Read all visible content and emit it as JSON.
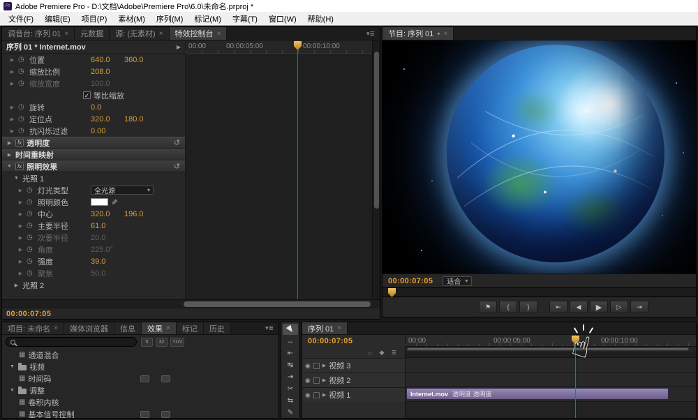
{
  "window": {
    "title": "Adobe Premiere Pro - D:\\文档\\Adobe\\Premiere Pro\\6.0\\未命名.prproj *",
    "app_icon": "Pr"
  },
  "menu": {
    "items": [
      "文件(F)",
      "编辑(E)",
      "项目(P)",
      "素材(M)",
      "序列(M)",
      "标记(M)",
      "字幕(T)",
      "窗口(W)",
      "帮助(H)"
    ]
  },
  "effect_controls": {
    "tabs": [
      {
        "label": "调音台: 序列 01",
        "closable": true,
        "active": false
      },
      {
        "label": "元数据",
        "closable": false,
        "active": false
      },
      {
        "label": "源: (无素材)",
        "closable": true,
        "active": false
      },
      {
        "label": "特效控制台",
        "closable": true,
        "active": true
      }
    ],
    "clip_header": "序列 01 * Internet.mov",
    "ruler_labels": [
      "00:00",
      "00:00:05:00",
      "00:00:10:00"
    ],
    "footer_timecode": "00:00:07:05",
    "rows": [
      {
        "kind": "param",
        "label": "位置",
        "values": [
          "640.0",
          "360.0"
        ],
        "indent": 0
      },
      {
        "kind": "param",
        "label": "缩放比例",
        "values": [
          "208.0"
        ],
        "indent": 0
      },
      {
        "kind": "param",
        "label": "缩放宽度",
        "values": [
          "100.0"
        ],
        "disabled": true,
        "indent": 0
      },
      {
        "kind": "check",
        "label": "等比缩放",
        "checked": true
      },
      {
        "kind": "param",
        "label": "旋转",
        "values": [
          "0.0"
        ],
        "indent": 0
      },
      {
        "kind": "param",
        "label": "定位点",
        "values": [
          "320.0",
          "180.0"
        ],
        "indent": 0
      },
      {
        "kind": "param",
        "label": "抗闪烁过滤",
        "values": [
          "0.00"
        ],
        "indent": 0
      },
      {
        "kind": "section",
        "label": "透明度",
        "fx": true,
        "reset": true,
        "expanded": false
      },
      {
        "kind": "section",
        "label": "时间重映射",
        "expanded": false
      },
      {
        "kind": "section",
        "label": "照明效果",
        "fx": true,
        "reset": true,
        "expanded": true
      },
      {
        "kind": "group",
        "label": "光照 1",
        "expanded": true,
        "indent": 1
      },
      {
        "kind": "dropdown",
        "label": "灯光类型",
        "value": "全光源",
        "indent": 2
      },
      {
        "kind": "color",
        "label": "照明颜色",
        "indent": 2
      },
      {
        "kind": "param",
        "label": "中心",
        "values": [
          "320.0",
          "196.0"
        ],
        "indent": 2
      },
      {
        "kind": "param",
        "label": "主要半径",
        "values": [
          "61.0"
        ],
        "indent": 2
      },
      {
        "kind": "param",
        "label": "次要半径",
        "values": [
          "20.0"
        ],
        "disabled": true,
        "indent": 2
      },
      {
        "kind": "param",
        "label": "角度",
        "values": [
          "225.0°"
        ],
        "disabled": true,
        "indent": 2
      },
      {
        "kind": "param",
        "label": "强度",
        "values": [
          "39.0"
        ],
        "indent": 2
      },
      {
        "kind": "param",
        "label": "聚焦",
        "values": [
          "50.0"
        ],
        "disabled": true,
        "indent": 2
      },
      {
        "kind": "group",
        "label": "光照 2",
        "expanded": false,
        "indent": 1
      }
    ]
  },
  "program_monitor": {
    "tab": "节目: 序列 01",
    "timecode": "00:00:07:05",
    "fit_label": "适合",
    "transport": [
      {
        "name": "add-marker",
        "glyph": "⚑"
      },
      {
        "name": "mark-in",
        "glyph": "{"
      },
      {
        "name": "mark-out",
        "glyph": "}"
      },
      {
        "name": "go-to-in",
        "glyph": "⇤",
        "gap": true
      },
      {
        "name": "step-back",
        "glyph": "◀"
      },
      {
        "name": "play",
        "glyph": "▶"
      },
      {
        "name": "step-forward",
        "glyph": "▷"
      },
      {
        "name": "go-to-out",
        "glyph": "⇥"
      }
    ]
  },
  "effects_panel": {
    "tabs": [
      {
        "label": "项目: 未命名",
        "closable": true,
        "active": false
      },
      {
        "label": "媒体浏览器",
        "closable": false,
        "active": false
      },
      {
        "label": "信息",
        "closable": false,
        "active": false
      },
      {
        "label": "效果",
        "closable": true,
        "active": true
      },
      {
        "label": "标记",
        "closable": false,
        "active": false
      },
      {
        "label": "历史",
        "closable": false,
        "active": false
      }
    ],
    "search_value": "",
    "toolbar_icons": [
      {
        "name": "accelerated-effects-icon",
        "glyph": "↯"
      },
      {
        "name": "32bit-color-icon",
        "glyph": "32"
      },
      {
        "name": "yuv-effects-icon",
        "glyph": "YUV"
      }
    ],
    "rows": [
      {
        "indent": 1,
        "icon": "effect",
        "label": "通道混合"
      },
      {
        "indent": 0,
        "icon": "folder",
        "label": "视频",
        "expanded": true
      },
      {
        "indent": 1,
        "icon": "effect",
        "label": "时间码",
        "badges": 2
      },
      {
        "indent": 0,
        "icon": "folder",
        "label": "调整",
        "expanded": true
      },
      {
        "indent": 1,
        "icon": "effect",
        "label": "卷积内核"
      },
      {
        "indent": 1,
        "icon": "effect",
        "label": "基本信号控制",
        "badges": 2
      }
    ]
  },
  "tools": {
    "items": [
      {
        "name": "selection-tool",
        "shape": "arrow",
        "active": true
      },
      {
        "name": "track-select-tool",
        "glyph": "↔"
      },
      {
        "name": "ripple-edit-tool",
        "glyph": "⇤"
      },
      {
        "name": "rolling-edit-tool",
        "glyph": "↹"
      },
      {
        "name": "rate-stretch-tool",
        "glyph": "⇥"
      },
      {
        "name": "razor-tool",
        "glyph": "✂"
      },
      {
        "name": "slip-tool",
        "glyph": "⇆"
      },
      {
        "name": "pen-tool",
        "glyph": "✎"
      }
    ]
  },
  "timeline": {
    "tab": "序列 01",
    "timecode": "00:00:07:05",
    "ruler_labels": [
      "00:00",
      "00:00:05:00",
      "00:00:10:00"
    ],
    "controls": [
      {
        "name": "snap-icon",
        "glyph": "∩"
      },
      {
        "name": "add-marker-icon",
        "glyph": "◆"
      },
      {
        "name": "settings-icon",
        "glyph": "≣"
      }
    ],
    "tracks": [
      {
        "label": "视频 3",
        "has_clip": false
      },
      {
        "label": "视频 2",
        "has_clip": false
      },
      {
        "label": "视频 1",
        "has_clip": true
      }
    ],
    "clip": {
      "name": "Internet.mov",
      "effect": "透明度:透明度"
    }
  },
  "colors": {
    "accent_gold": "#e8a030",
    "value_gold": "#d79e3c",
    "playhead_red": "#c8382b",
    "clip_purple": "#8374a0"
  }
}
